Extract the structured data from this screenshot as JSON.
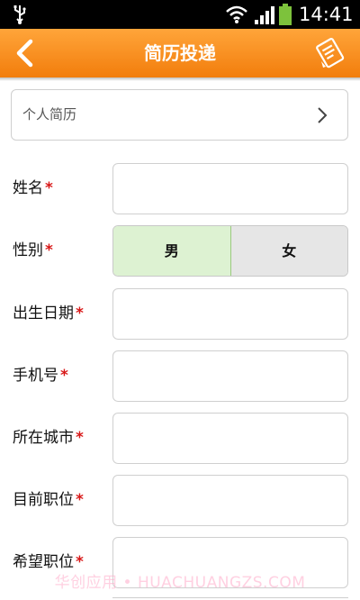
{
  "status_bar": {
    "time": "14:41",
    "icons": [
      "usb-icon",
      "wifi-icon",
      "signal-icon",
      "battery-icon"
    ]
  },
  "header": {
    "title": "简历投递",
    "back_icon": "back-chevron-icon",
    "action_icon": "document-pen-icon"
  },
  "resume_selector": {
    "label": "个人简历",
    "icon": "chevron-right-icon"
  },
  "form": {
    "required_mark": "*",
    "name_label": "姓名",
    "gender_label": "性别",
    "gender_options": {
      "male": "男",
      "female": "女",
      "selected": "男"
    },
    "birth_label": "出生日期",
    "phone_label": "手机号",
    "city_label": "所在城市",
    "current_position_label": "目前职位",
    "desired_position_label": "希望职位"
  },
  "watermark": "华创应用 • HUACHUANGZS.COM",
  "colors": {
    "header": "#f5880f",
    "required": "#d81818",
    "selected_option": "#ddf2d2"
  }
}
